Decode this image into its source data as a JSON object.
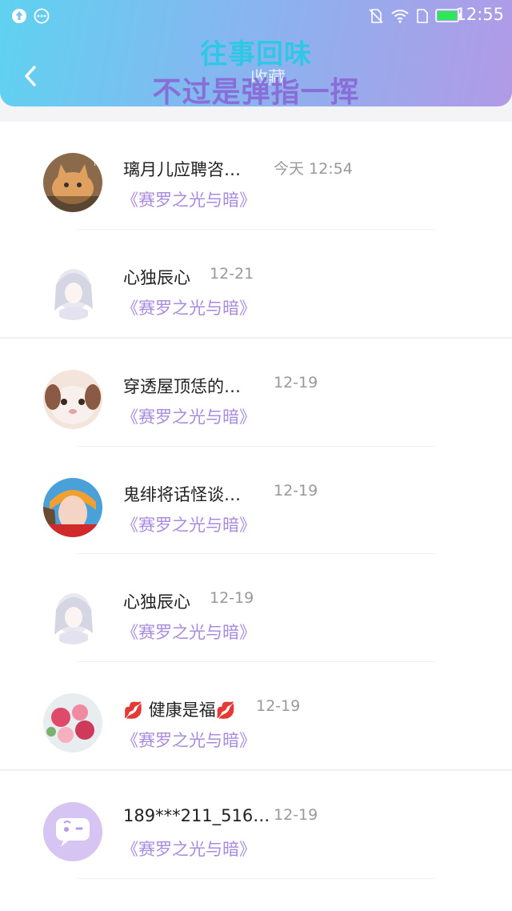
{
  "status_bar": {
    "time": "12:55"
  },
  "header": {
    "title": "收藏",
    "overlay_line1": "往事回味",
    "overlay_line2": "不过是弹指一挥"
  },
  "list": [
    {
      "name": "璃月儿应聘咨…",
      "time": "今天 12:54",
      "book": "《赛罗之光与暗》",
      "avatar": "cat-avatar"
    },
    {
      "name": "心独辰心",
      "time": "12-21",
      "book": "《赛罗之光与暗》",
      "avatar": "anime-girl-avatar"
    },
    {
      "name": "穿透屋顶恁的…",
      "time": "12-19",
      "book": "《赛罗之光与暗》",
      "avatar": "rabbit-avatar"
    },
    {
      "name": "鬼绯将话怪谈…",
      "time": "12-19",
      "book": "《赛罗之光与暗》",
      "avatar": "girl-photo-avatar"
    },
    {
      "name": "心独辰心",
      "time": "12-19",
      "book": "《赛罗之光与暗》",
      "avatar": "anime-girl-avatar"
    },
    {
      "name": "健康是福",
      "name_emoji": "💋",
      "time": "12-19",
      "book": "《赛罗之光与暗》",
      "avatar": "flowers-avatar"
    },
    {
      "name": "189***211_516…",
      "time": "12-19",
      "book": "《赛罗之光与暗》",
      "avatar": "default-chat-avatar"
    }
  ],
  "colors": {
    "accent": "#a88bdf",
    "header_start": "#5fd2f0",
    "header_end": "#b19ae6"
  }
}
